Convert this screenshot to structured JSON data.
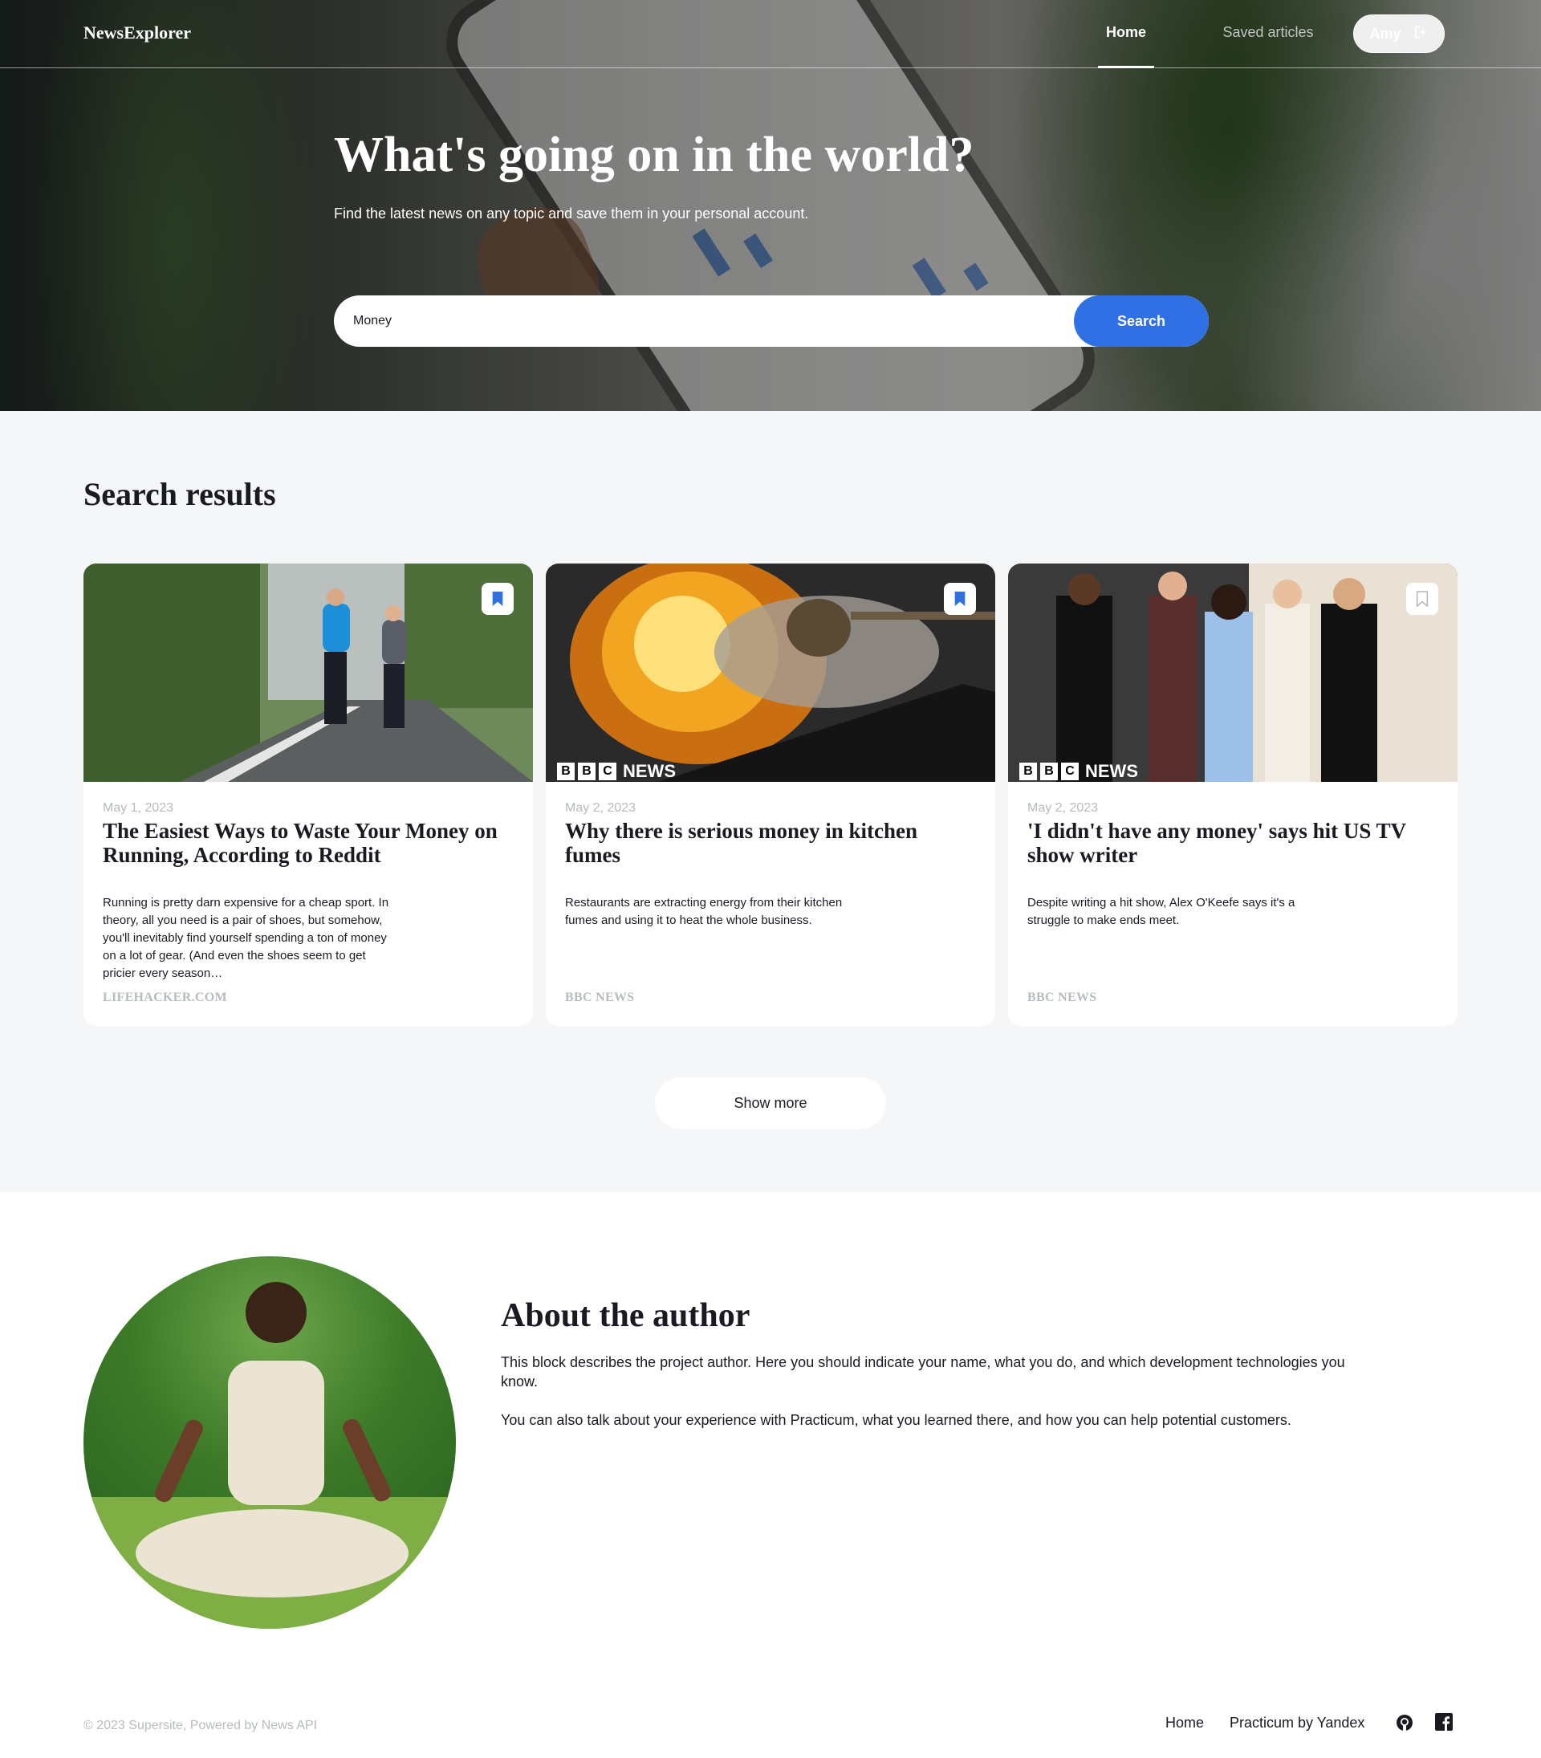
{
  "header": {
    "logo": "NewsExplorer",
    "nav": {
      "home": "Home",
      "saved": "Saved articles",
      "user": "Amy"
    }
  },
  "hero": {
    "title": "What's going on in the world?",
    "subtitle": "Find the latest news on any topic and save them in your personal account.",
    "search_value": "Money",
    "search_button": "Search"
  },
  "results": {
    "title": "Search results",
    "cards": [
      {
        "date": "May 1, 2023",
        "title": "The Easiest Ways to Waste Your Money on Running, According to Reddit",
        "text": "Running is pretty darn expensive for a cheap sport. In theory, all you need is a pair of shoes, but somehow, you'll inevitably find yourself spending a ton of money on a lot of gear. (And even the shoes seem to get pricier every season…",
        "source": "LIFEHACKER.COM",
        "saved": true
      },
      {
        "date": "May 2, 2023",
        "title": "Why there is serious money in kitchen fumes",
        "text": "Restaurants are extracting energy from their kitchen fumes and using it to heat the whole business.",
        "source": "BBC NEWS",
        "saved": true,
        "image_logo": {
          "b1": "B",
          "b2": "B",
          "b3": "C",
          "news": "NEWS"
        }
      },
      {
        "date": "May 2, 2023",
        "title": "'I didn't have any money' says hit US TV show writer",
        "text": "Despite writing a hit show, Alex O'Keefe says it's a struggle to make ends meet.",
        "source": "BBC NEWS",
        "saved": false,
        "image_logo": {
          "b1": "B",
          "b2": "B",
          "b3": "C",
          "news": "NEWS"
        }
      }
    ],
    "show_more": "Show more"
  },
  "about": {
    "title": "About the author",
    "p1": "This block describes the project author. Here you should indicate your name, what you do, and which development technologies you know.",
    "p2": "You can also talk about your experience with Practicum, what you learned there, and how you can help potential customers."
  },
  "footer": {
    "copyright": "© 2023 Supersite, Powered by News API",
    "home": "Home",
    "practicum": "Practicum by Yandex"
  },
  "icons": {
    "logout": "logout-icon",
    "bookmark": "bookmark-icon",
    "github": "github-icon",
    "facebook": "facebook-icon"
  },
  "colors": {
    "accent": "#2f71e5",
    "text": "#1a1b22",
    "muted": "#b6bcbf",
    "section_bg": "#f5f6f7"
  }
}
